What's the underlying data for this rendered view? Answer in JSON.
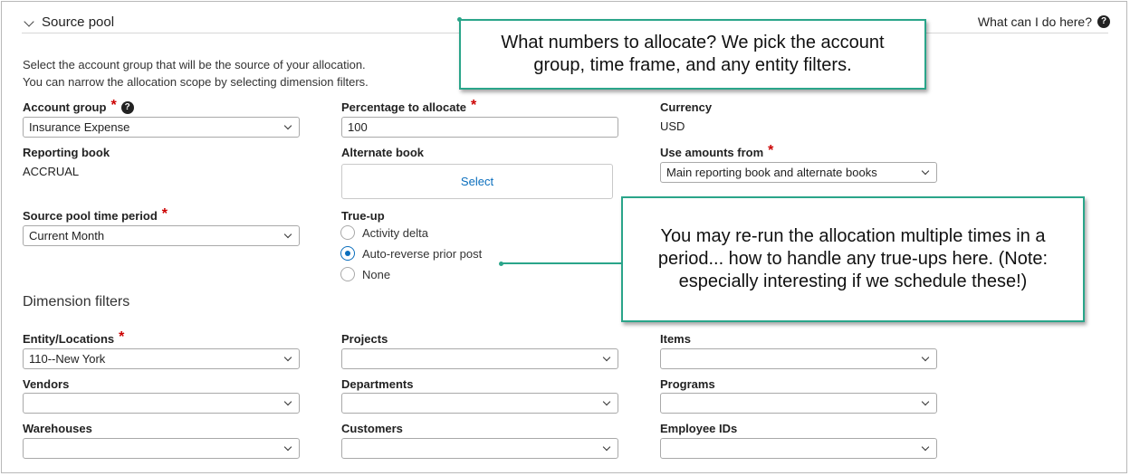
{
  "header": {
    "section_title": "Source pool",
    "help_link": "What can I do here?"
  },
  "description": {
    "line1": "Select the account group that will be the source of your allocation.",
    "line2": "You can narrow the allocation scope by selecting dimension filters."
  },
  "fields": {
    "account_group": {
      "label": "Account group",
      "value": "Insurance Expense"
    },
    "percentage": {
      "label": "Percentage to allocate",
      "value": "100"
    },
    "currency": {
      "label": "Currency",
      "value": "USD"
    },
    "reporting_book": {
      "label": "Reporting book",
      "value": "ACCRUAL"
    },
    "alternate_book": {
      "label": "Alternate book",
      "button": "Select"
    },
    "use_amounts": {
      "label": "Use amounts from",
      "value": "Main reporting book and alternate books"
    },
    "time_period": {
      "label": "Source pool time period",
      "value": "Current Month"
    },
    "true_up": {
      "label": "True-up",
      "options": [
        "Activity delta",
        "Auto-reverse prior post",
        "None"
      ],
      "selected": "Auto-reverse prior post"
    }
  },
  "dimension_filters": {
    "title": "Dimension filters",
    "entity": {
      "label": "Entity/Locations",
      "value": "110--New York"
    },
    "projects": {
      "label": "Projects",
      "value": ""
    },
    "items": {
      "label": "Items",
      "value": ""
    },
    "vendors": {
      "label": "Vendors",
      "value": ""
    },
    "departments": {
      "label": "Departments",
      "value": ""
    },
    "programs": {
      "label": "Programs",
      "value": ""
    },
    "warehouses": {
      "label": "Warehouses",
      "value": ""
    },
    "customers": {
      "label": "Customers",
      "value": ""
    },
    "employee_ids": {
      "label": "Employee IDs",
      "value": ""
    }
  },
  "annotations": {
    "callout1": "What numbers to allocate? We pick the account group, time frame, and any entity filters.",
    "callout2": "You may re-run the allocation multiple times in a period... how to handle any true-ups here. (Note: especially interesting if we schedule these!)"
  },
  "colors": {
    "accent": "#0a6ebd",
    "required": "#cc0000",
    "callout_border": "#2aa58a"
  }
}
